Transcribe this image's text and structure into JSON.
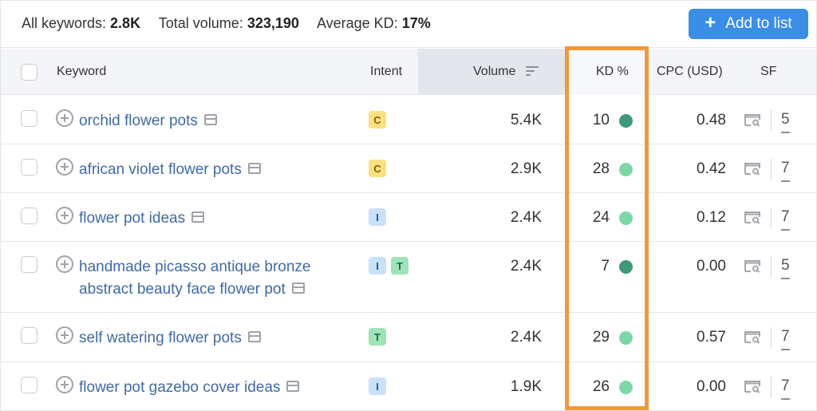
{
  "summary": {
    "all_keywords_label": "All keywords:",
    "all_keywords_value": "2.8K",
    "total_volume_label": "Total volume:",
    "total_volume_value": "323,190",
    "average_kd_label": "Average KD:",
    "average_kd_value": "17%"
  },
  "actions": {
    "add_to_list_icon": "plus-icon",
    "add_to_list_label": "Add to list"
  },
  "colors": {
    "accent": "#3a8ee6",
    "highlight": "#f0993b",
    "kd_dark": "#3f9a78",
    "kd_light": "#7dd8a7",
    "intent_c": "#fbdf81",
    "intent_i": "#c9e1fb",
    "intent_t": "#9fe3b8"
  },
  "table": {
    "headers": {
      "keyword": "Keyword",
      "intent": "Intent",
      "volume": "Volume",
      "kd": "KD %",
      "cpc": "CPC (USD)",
      "sf": "SF"
    },
    "sorted_by": "Volume",
    "highlighted_column": "KD %",
    "rows": [
      {
        "keyword_lines": [
          "orchid flower pots"
        ],
        "intents": [
          "C"
        ],
        "volume": "5.4K",
        "kd": "10",
        "kd_level": "dark",
        "cpc": "0.48",
        "sf": "5"
      },
      {
        "keyword_lines": [
          "african violet flower pots"
        ],
        "intents": [
          "C"
        ],
        "volume": "2.9K",
        "kd": "28",
        "kd_level": "light",
        "cpc": "0.42",
        "sf": "7"
      },
      {
        "keyword_lines": [
          "flower pot ideas"
        ],
        "intents": [
          "I"
        ],
        "volume": "2.4K",
        "kd": "24",
        "kd_level": "light",
        "cpc": "0.12",
        "sf": "7"
      },
      {
        "keyword_lines": [
          "handmade picasso antique bronze",
          "abstract beauty face flower pot"
        ],
        "intents": [
          "I",
          "T"
        ],
        "volume": "2.4K",
        "kd": "7",
        "kd_level": "dark",
        "cpc": "0.00",
        "sf": "5"
      },
      {
        "keyword_lines": [
          "self watering flower pots"
        ],
        "intents": [
          "T"
        ],
        "volume": "2.4K",
        "kd": "29",
        "kd_level": "light",
        "cpc": "0.57",
        "sf": "7"
      },
      {
        "keyword_lines": [
          "flower pot gazebo cover ideas"
        ],
        "intents": [
          "I"
        ],
        "volume": "1.9K",
        "kd": "26",
        "kd_level": "light",
        "cpc": "0.00",
        "sf": "7"
      }
    ]
  }
}
